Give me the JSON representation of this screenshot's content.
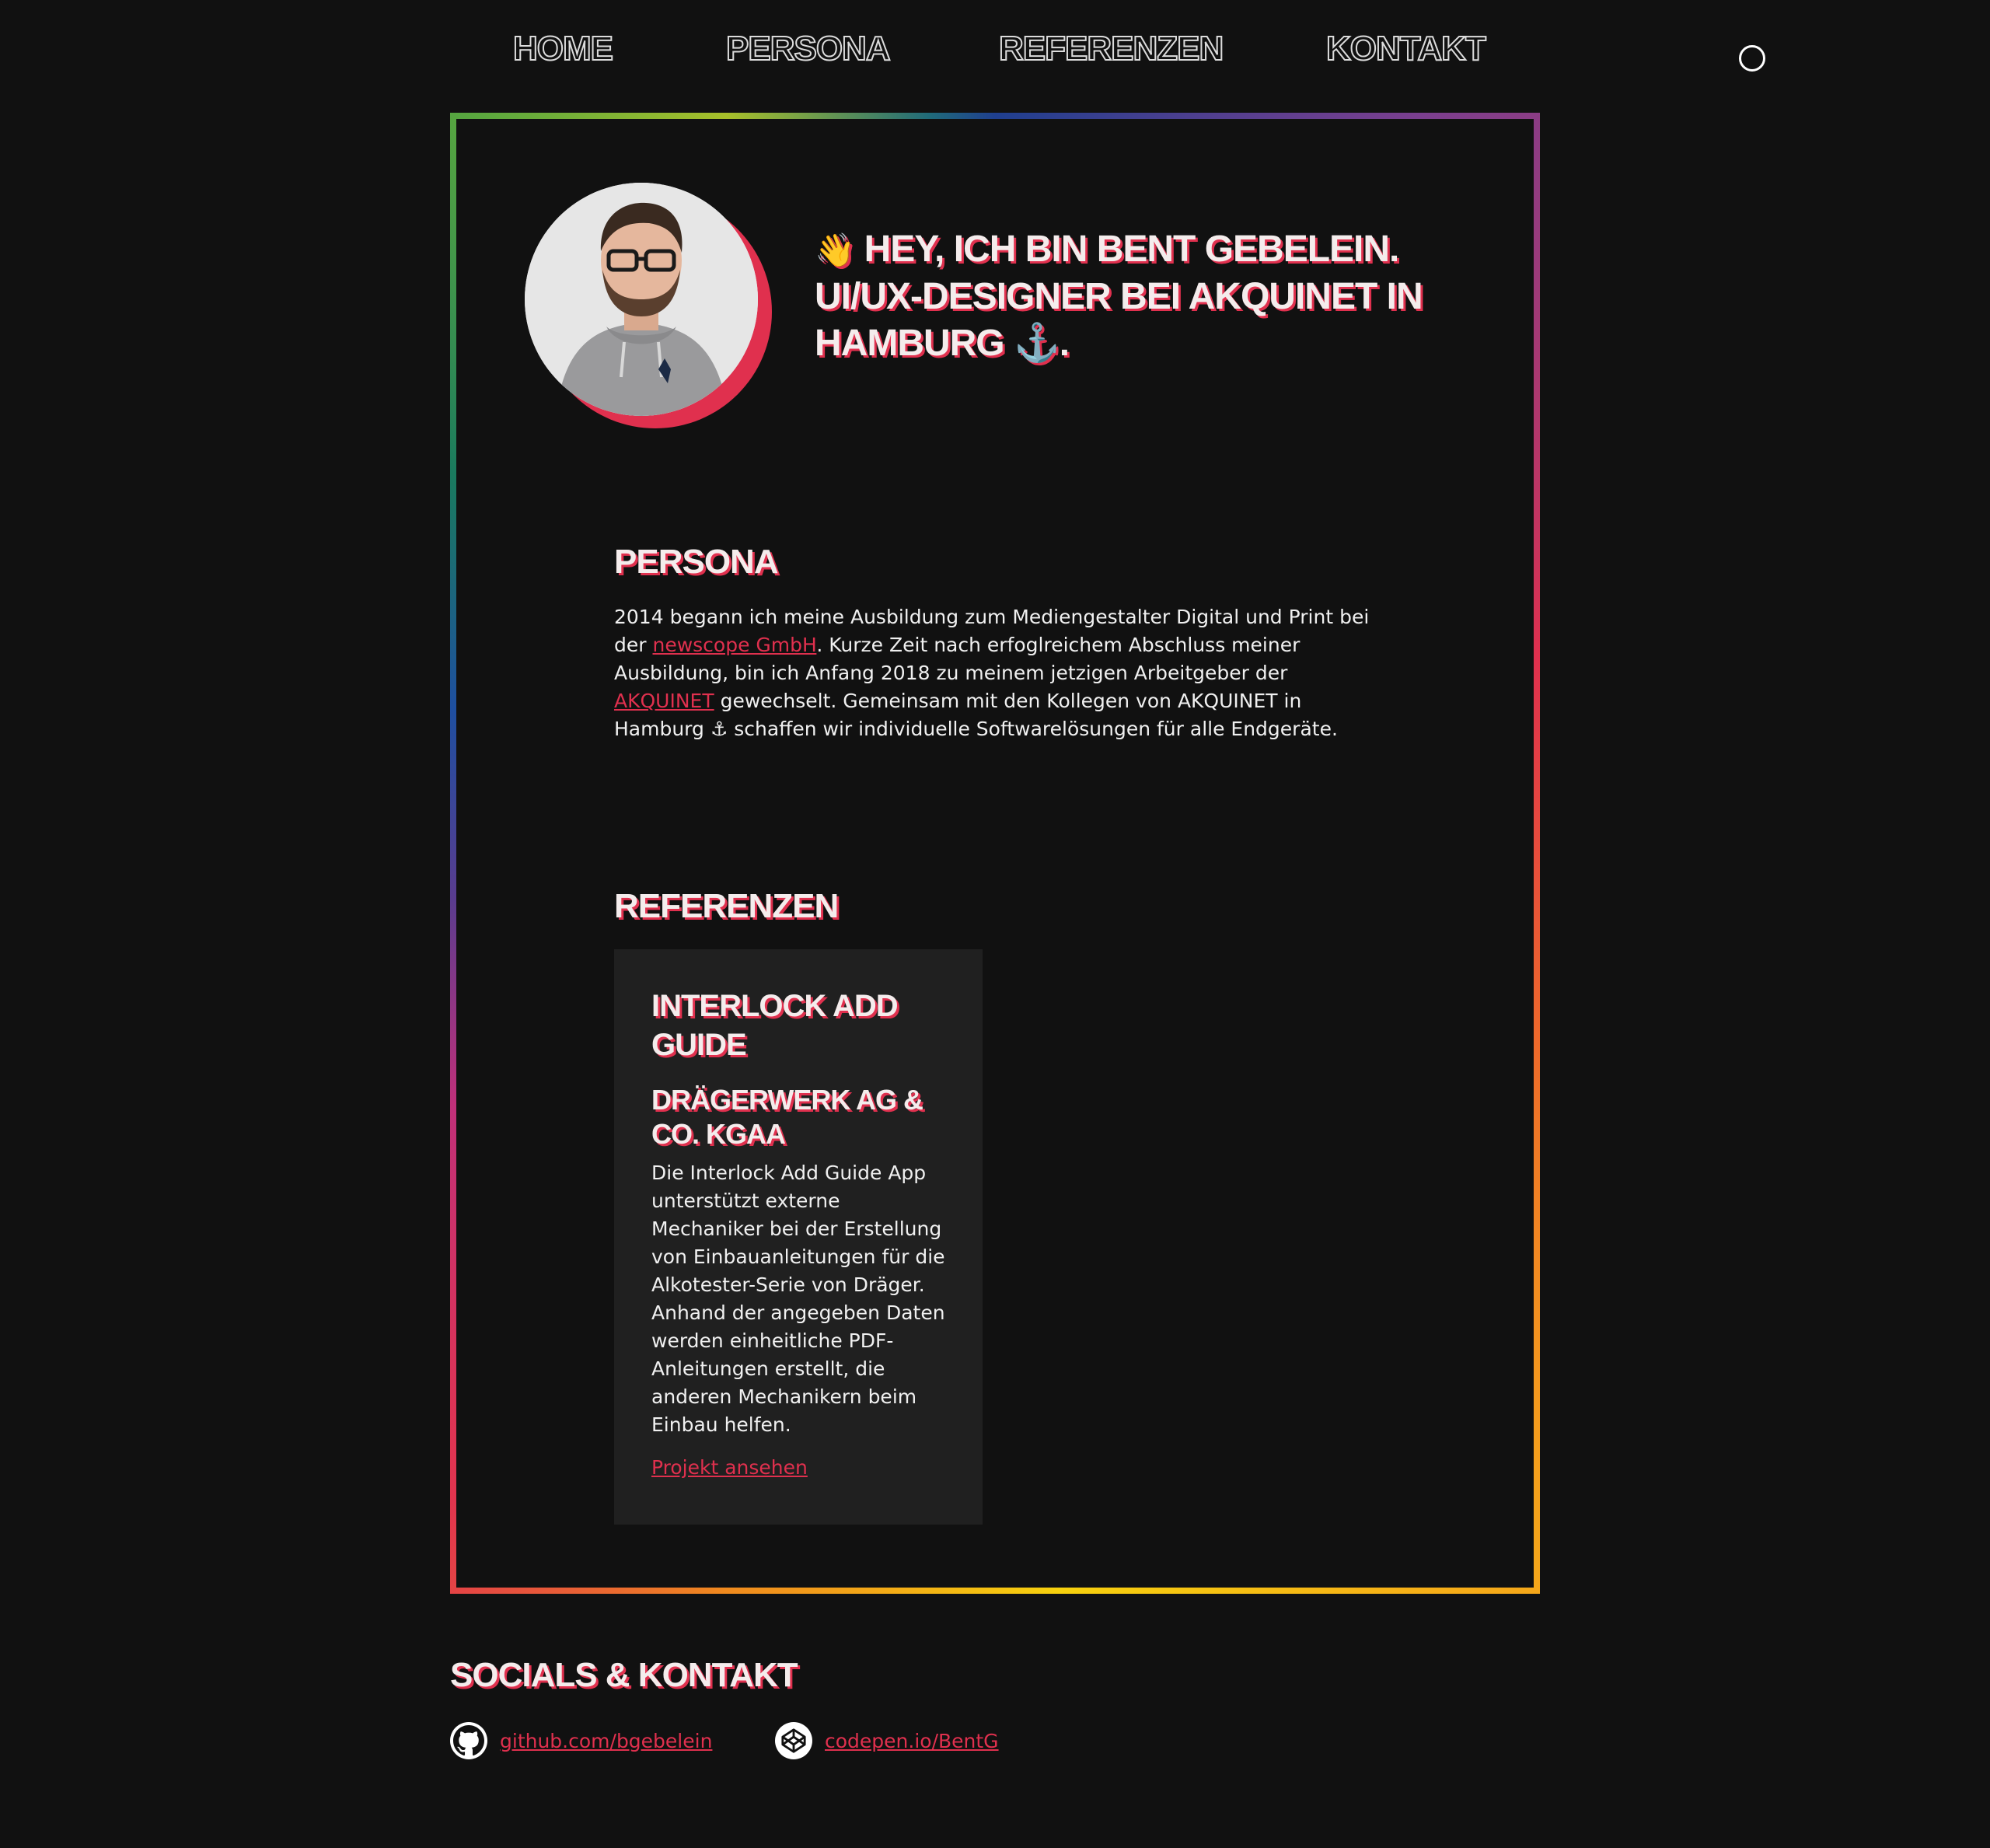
{
  "nav": {
    "items": [
      {
        "label": "HOME"
      },
      {
        "label": "PERSONA"
      },
      {
        "label": "REFERENZEN"
      },
      {
        "label": "KONTAKT"
      }
    ]
  },
  "hero": {
    "wave": "👋",
    "title": "HEY, ICH BIN BENT GEBELEIN. UI/UX-DESIGNER BEI AKQUINET IN HAMBURG ⚓."
  },
  "persona": {
    "title": "PERSONA",
    "text_1": "2014 begann ich meine Ausbildung zum Mediengestalter Digital und Print bei der ",
    "link_1": "newscope GmbH",
    "text_2": ". Kurze Zeit nach erfoglreichem Abschluss meiner Ausbildung, bin ich Anfang 2018 zu meinem jetzigen Arbeitgeber der ",
    "link_2": "AKQUINET",
    "text_3": " gewechselt. Gemeinsam mit den Kollegen von AKQUINET in Hamburg ⚓ schaffen wir individuelle Softwarelösungen für alle Endgeräte."
  },
  "references": {
    "title": "REFERENZEN",
    "cards": [
      {
        "title": "INTERLOCK ADD GUIDE",
        "client": "DRÄGERWERK AG & CO. KGAA",
        "description": "Die Interlock Add Guide App unterstützt externe Mechaniker bei der Erstellung von Einbauanleitungen für die Alkotester-Serie von Dräger. Anhand der angegeben Daten werden einheitliche PDF-Anleitungen erstellt, die anderen Mechanikern beim Einbau helfen.",
        "link": "Projekt ansehen"
      }
    ]
  },
  "socials": {
    "title": "SOCIALS & KONTAKT",
    "links": [
      {
        "icon": "github-icon",
        "label": "github.com/bgebelein"
      },
      {
        "icon": "codepen-icon",
        "label": "codepen.io/BentG"
      }
    ]
  },
  "colors": {
    "background": "#111111",
    "card": "#202020",
    "accent": "#e0304e"
  }
}
